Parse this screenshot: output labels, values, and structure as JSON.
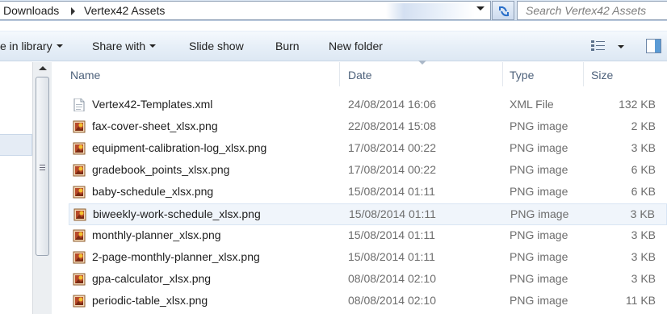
{
  "address_bar": {
    "crumbs": [
      "Downloads",
      "Vertex42 Assets"
    ],
    "search_placeholder": "Search Vertex42 Assets"
  },
  "toolbar": {
    "include_label": "e in library",
    "share_label": "Share with",
    "slideshow_label": "Slide show",
    "burn_label": "Burn",
    "new_folder_label": "New folder"
  },
  "columns": {
    "name": "Name",
    "date": "Date",
    "type": "Type",
    "size": "Size"
  },
  "files": [
    {
      "name": "Vertex42-Templates.xml",
      "date": "24/08/2014 16:06",
      "type": "XML File",
      "size": "132 KB",
      "icon": "xml-file-icon"
    },
    {
      "name": "fax-cover-sheet_xlsx.png",
      "date": "22/08/2014 15:08",
      "type": "PNG image",
      "size": "2 KB",
      "icon": "png-file-icon"
    },
    {
      "name": "equipment-calibration-log_xlsx.png",
      "date": "17/08/2014 00:22",
      "type": "PNG image",
      "size": "3 KB",
      "icon": "png-file-icon"
    },
    {
      "name": "gradebook_points_xlsx.png",
      "date": "17/08/2014 00:22",
      "type": "PNG image",
      "size": "6 KB",
      "icon": "png-file-icon"
    },
    {
      "name": "baby-schedule_xlsx.png",
      "date": "15/08/2014 01:11",
      "type": "PNG image",
      "size": "6 KB",
      "icon": "png-file-icon"
    },
    {
      "name": "biweekly-work-schedule_xlsx.png",
      "date": "15/08/2014 01:11",
      "type": "PNG image",
      "size": "3 KB",
      "icon": "png-file-icon"
    },
    {
      "name": "monthly-planner_xlsx.png",
      "date": "15/08/2014 01:11",
      "type": "PNG image",
      "size": "3 KB",
      "icon": "png-file-icon"
    },
    {
      "name": "2-page-monthly-planner_xlsx.png",
      "date": "15/08/2014 01:11",
      "type": "PNG image",
      "size": "3 KB",
      "icon": "png-file-icon"
    },
    {
      "name": "gpa-calculator_xlsx.png",
      "date": "08/08/2014 02:10",
      "type": "PNG image",
      "size": "3 KB",
      "icon": "png-file-icon"
    },
    {
      "name": "periodic-table_xlsx.png",
      "date": "08/08/2014 02:10",
      "type": "PNG image",
      "size": "11 KB",
      "icon": "png-file-icon"
    }
  ],
  "hovered_row": 5
}
